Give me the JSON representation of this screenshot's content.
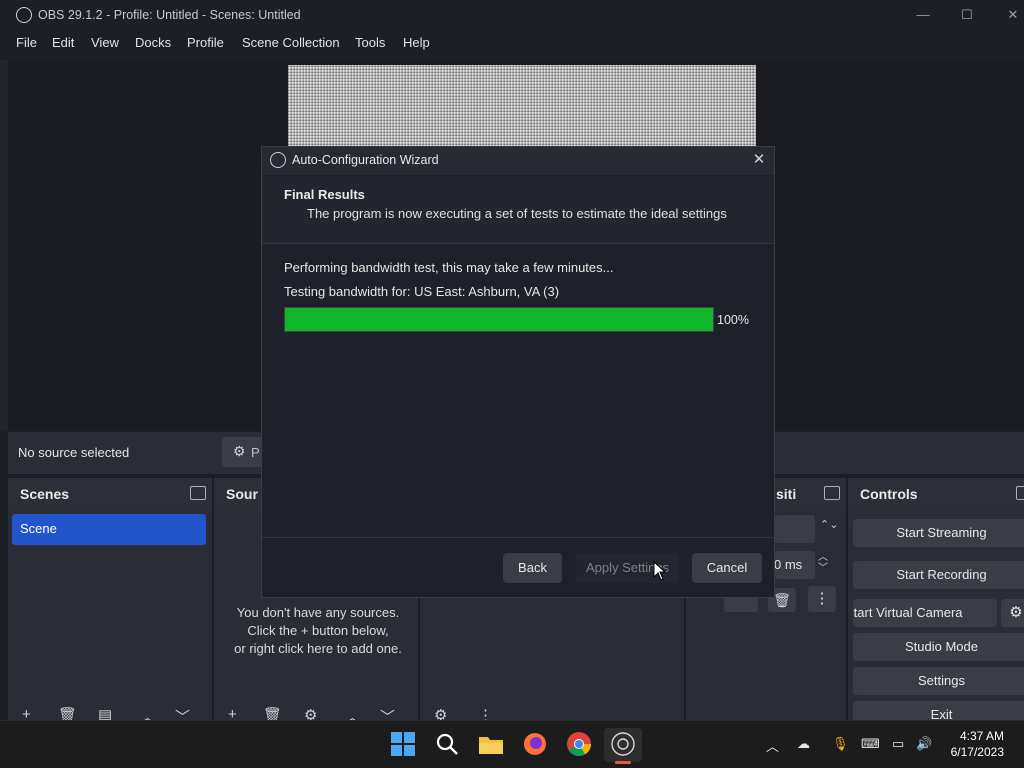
{
  "window": {
    "title": "OBS 29.1.2 - Profile: Untitled - Scenes: Untitled",
    "minimize": "—",
    "maximize": "☐",
    "close": "✕"
  },
  "menu": [
    "File",
    "Edit",
    "View",
    "Docks",
    "Profile",
    "Scene Collection",
    "Tools",
    "Help"
  ],
  "source_bar": {
    "no_source": "No source selected",
    "properties_button": "P"
  },
  "docks": {
    "scenes": {
      "title": "Scenes",
      "items": [
        "Scene"
      ]
    },
    "sources": {
      "title": "Sour",
      "empty_line1": "You don't have any sources.",
      "empty_line2": "Click the + button below,",
      "empty_line3": "or right click here to add one."
    },
    "transitions": {
      "title": "siti",
      "duration_suffix": "0 ms"
    },
    "controls": {
      "title": "Controls",
      "start_streaming": "Start Streaming",
      "start_recording": "Start Recording",
      "start_virtual_camera": "Start Virtual Camera",
      "studio_mode": "Studio Mode",
      "settings": "Settings",
      "exit": "Exit"
    }
  },
  "dialog": {
    "title": "Auto-Configuration Wizard",
    "close": "✕",
    "header_title": "Final Results",
    "header_desc": "The program is now executing a set of tests to estimate the ideal settings",
    "status_line": "Performing bandwidth test, this may take a few minutes...",
    "testing_line": "Testing bandwidth for: US East: Ashburn, VA (3)",
    "progress_percent": 100,
    "progress_label": "100%",
    "buttons": {
      "back": "Back",
      "apply": "Apply Settings",
      "cancel": "Cancel"
    }
  },
  "taskbar": {
    "time": "4:37 AM",
    "date": "6/17/2023",
    "apps": [
      "windows-start-icon",
      "search-icon",
      "file-explorer-icon",
      "firefox-icon",
      "chrome-icon",
      "obs-icon"
    ]
  },
  "colors": {
    "accent_scene": "#2255c9",
    "progress_fill": "#10b72a"
  }
}
